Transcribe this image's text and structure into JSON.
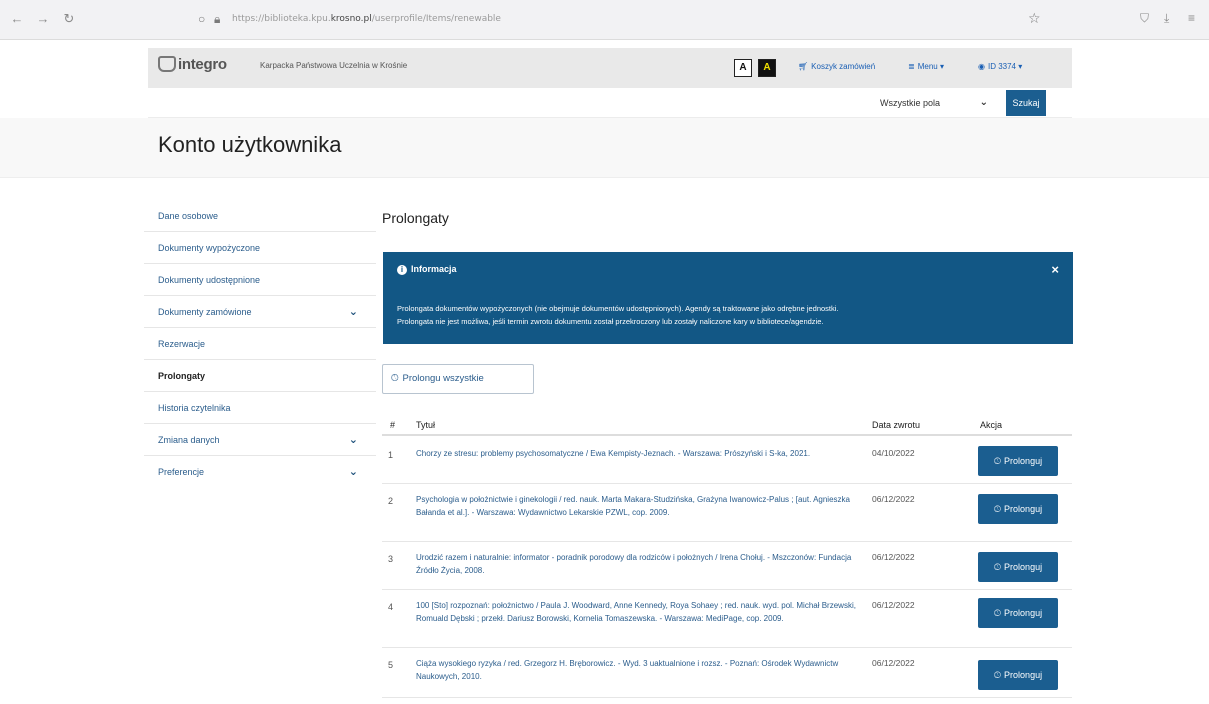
{
  "browser": {
    "url_prefix": "https://biblioteka.kpu.",
    "url_domain": "krosno.pl",
    "url_path": "/userprofile/Items/renewable"
  },
  "header": {
    "logo_text": "integro",
    "university": "Karpacka Państwowa Uczelnia w Krośnie",
    "contrast_light": "A",
    "contrast_dark": "A",
    "cart_label": "Koszyk zamówień",
    "menu_label": "Menu",
    "user_label": "ID 3374"
  },
  "search": {
    "placeholder": "",
    "field_select": "Wszystkie pola",
    "button_label": "Szukaj"
  },
  "page": {
    "title": "Konto użytkownika"
  },
  "sidebar": {
    "items": [
      {
        "label": "Dane osobowe"
      },
      {
        "label": "Dokumenty wypożyczone"
      },
      {
        "label": "Dokumenty udostępnione"
      },
      {
        "label": "Dokumenty zamówione"
      },
      {
        "label": "Rezerwacje"
      },
      {
        "label": "Prolongaty"
      },
      {
        "label": "Historia czytelnika"
      },
      {
        "label": "Zmiana danych"
      },
      {
        "label": "Preferencje"
      }
    ]
  },
  "main": {
    "section_title": "Prolongaty",
    "info": {
      "heading": "Informacja",
      "line1": "Prolongata dokumentów wypożyczonych (nie obejmuje dokumentów udostępnionych). Agendy są traktowane jako odrębne jednostki.",
      "line2": "Prolongata nie jest możliwa, jeśli termin zwrotu dokumentu został przekroczony lub zostały naliczone kary w bibliotece/agendzie."
    },
    "renew_all_label": "Prolongu wszystkie",
    "table": {
      "col_no": "#",
      "col_title": "Tytuł",
      "col_date": "Data zwrotu",
      "col_action": "Akcja",
      "button_label": "Prolonguj",
      "rows": [
        {
          "no": "1",
          "title": "Chorzy ze stresu: problemy psychosomatyczne / Ewa Kempisty-Jeznach. - Warszawa: Prószyński i S-ka, 2021.",
          "date": "04/10/2022"
        },
        {
          "no": "2",
          "title": "Psychologia w położnictwie i ginekologii / red. nauk. Marta Makara-Studzińska, Grażyna Iwanowicz-Palus ; [aut. Agnieszka Bałanda et al.]. - Warszawa: Wydawnictwo Lekarskie PZWL, cop. 2009.",
          "date": "06/12/2022"
        },
        {
          "no": "3",
          "title": "Urodzić razem i naturalnie: informator - poradnik porodowy dla rodziców i położnych / Irena Chołuj. - Mszczonów: Fundacja Źródło Życia, 2008.",
          "date": "06/12/2022"
        },
        {
          "no": "4",
          "title": "100 [Sto] rozpoznań: położnictwo / Paula J. Woodward, Anne Kennedy, Roya Sohaey ; red. nauk. wyd. pol. Michał Brzewski, Romuald Dębski ; przekł. Dariusz Borowski, Kornelia Tomaszewska. - Warszawa: MediPage, cop. 2009.",
          "date": "06/12/2022"
        },
        {
          "no": "5",
          "title": "Ciąża wysokiego ryzyka / red. Grzegorz H. Bręborowicz. - Wyd. 3 uaktualnione i rozsz. - Poznań: Ośrodek Wydawnictw Naukowych, 2010.",
          "date": "06/12/2022"
        }
      ]
    }
  }
}
